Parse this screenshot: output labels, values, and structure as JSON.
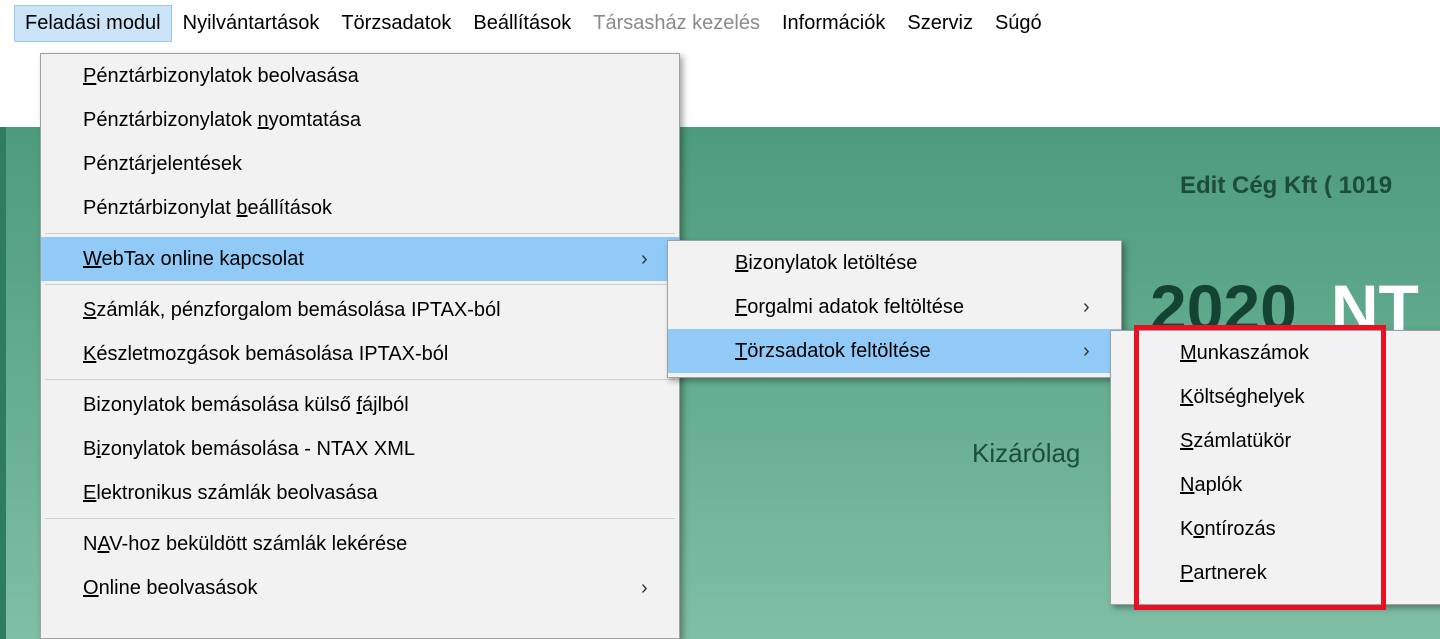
{
  "menubar": {
    "items": [
      {
        "label": "Feladási modul"
      },
      {
        "label": "Nyilvántartások"
      },
      {
        "label": "Törzsadatok"
      },
      {
        "label": "Beállítások"
      },
      {
        "label": "Társasház kezelés"
      },
      {
        "label": "Információk"
      },
      {
        "label": "Szerviz"
      },
      {
        "label": "Súgó"
      }
    ]
  },
  "background": {
    "company": "Edit Cég Kft ( 1019",
    "year": "2020",
    "title_suffix": "NT",
    "exclusive": "Kizárólag"
  },
  "main_menu": {
    "items": [
      {
        "pre": "",
        "u": "P",
        "post": "énztárbizonylatok beolvasása"
      },
      {
        "pre": "Pénztárbizonylatok ",
        "u": "n",
        "post": "yomtatása"
      },
      {
        "pre": "Pénztár",
        "u": "j",
        "post": "elentések"
      },
      {
        "pre": "Pénztárbizonylat ",
        "u": "b",
        "post": "eállítások"
      },
      {
        "pre": "",
        "u": "W",
        "post": "ebTax online kapcsolat"
      },
      {
        "pre": "",
        "u": "S",
        "post": "zámlák, pénzforgalom bemásolása IPTAX-ból"
      },
      {
        "pre": "",
        "u": "K",
        "post": "észletmozgások bemásolása IPTAX-ból"
      },
      {
        "pre": "Bizonylatok bemásolása külső ",
        "u": "f",
        "post": "ájlból"
      },
      {
        "pre": "B",
        "u": "i",
        "post": "zonylatok bemásolása - NTAX XML"
      },
      {
        "pre": "",
        "u": "E",
        "post": "lektronikus számlák beolvasása"
      },
      {
        "pre": "N",
        "u": "A",
        "post": "V-hoz beküldött számlák lekérése"
      },
      {
        "pre": "",
        "u": "O",
        "post": "nline beolvasások"
      }
    ]
  },
  "webtax_menu": {
    "items": [
      {
        "pre": "",
        "u": "B",
        "post": "izonylatok letöltése"
      },
      {
        "pre": "",
        "u": "F",
        "post": "orgalmi adatok feltöltése"
      },
      {
        "pre": "",
        "u": "T",
        "post": "örzsadatok feltöltése"
      }
    ]
  },
  "torzs_menu": {
    "items": [
      {
        "pre": "",
        "u": "M",
        "post": "unkaszámok"
      },
      {
        "pre": "",
        "u": "K",
        "post": "öltséghelyek"
      },
      {
        "pre": "",
        "u": "S",
        "post": "zámlatükör"
      },
      {
        "pre": "",
        "u": "N",
        "post": "aplók"
      },
      {
        "pre": "K",
        "u": "o",
        "post": "ntírozás"
      },
      {
        "pre": "",
        "u": "P",
        "post": "artnerek"
      }
    ]
  },
  "icons": {
    "submenu_arrow": "chevron-right-icon",
    "arrow_glyph": "›"
  },
  "colors": {
    "menu_highlight": "#91c9f7",
    "menubar_active": "#cce4f7",
    "annotation_box": "#e81123",
    "background_green": "#62ab8e"
  }
}
